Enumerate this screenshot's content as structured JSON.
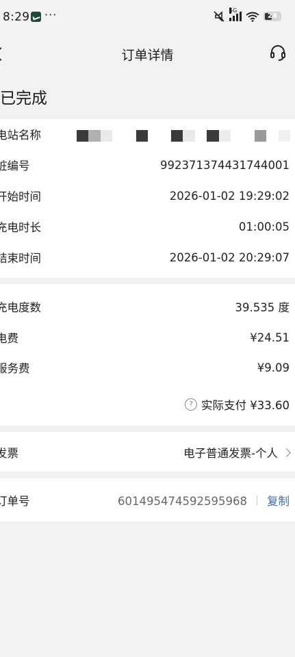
{
  "status_bar": {
    "time": "8:29",
    "more": "···",
    "network": "5G",
    "battery": "28"
  },
  "header": {
    "title": "订单详情"
  },
  "order_status": "已完成",
  "details": {
    "station_label": "电站名称",
    "pile_label": "桩编号",
    "pile_value": "992371374431744001",
    "start_label": "开始时间",
    "start_value": "2026-01-02 19:29:02",
    "duration_label": "充电时长",
    "duration_value": "01:00:05",
    "end_label": "结束时间",
    "end_value": "2026-01-02 20:29:07"
  },
  "fees": {
    "energy_label": "充电度数",
    "energy_value": "39.535 度",
    "electric_label": "电费",
    "electric_value": "¥24.51",
    "service_label": "服务费",
    "service_value": "¥9.09",
    "actual_pay_text": "实际支付 ¥33.60"
  },
  "invoice": {
    "label": "发票",
    "value": "电子普通发票-个人"
  },
  "order": {
    "label": "订单号",
    "value": "601495474592595968",
    "copy_label": "复制"
  }
}
